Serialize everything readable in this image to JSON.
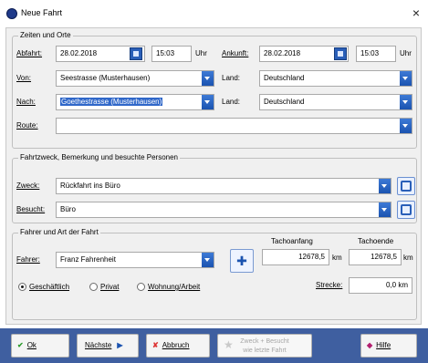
{
  "window": {
    "title": "Neue Fahrt",
    "close": "×"
  },
  "groups": {
    "zeiten": "Zeiten und Orte",
    "zweck": "Fahrtzweck, Bemerkung und besuchte Personen",
    "fahrer": "Fahrer und Art der Fahrt"
  },
  "zeiten": {
    "abfahrt_label": "Abfahrt:",
    "abfahrt_date": "28.02.2018",
    "abfahrt_time": "15:03",
    "abfahrt_unit": "Uhr",
    "ankunft_label": "Ankunft:",
    "ankunft_date": "28.02.2018",
    "ankunft_time": "15:03",
    "ankunft_unit": "Uhr",
    "von_label": "Von:",
    "von_value": "Seestrasse (Musterhausen)",
    "land1_label": "Land:",
    "land1_value": "Deutschland",
    "nach_label": "Nach:",
    "nach_value": "Goethestrasse (Musterhausen)",
    "land2_label": "Land:",
    "land2_value": "Deutschland",
    "route_label": "Route:",
    "route_value": ""
  },
  "zweck": {
    "zweck_label": "Zweck:",
    "zweck_value": "Rückfahrt ins Büro",
    "besucht_label": "Besucht:",
    "besucht_value": "Büro"
  },
  "fahrer": {
    "fahrer_label": "Fahrer:",
    "fahrer_value": "Franz Fahrenheit",
    "tachoanfang_label": "Tachoanfang",
    "tachoanfang_value": "12678,5",
    "tachoende_label": "Tachoende",
    "tachoende_value": "12678,5",
    "km1": "km",
    "km2": "km",
    "strecke_label": "Strecke:",
    "strecke_value": "0,0 km",
    "radio_geschaeftlich": "Geschäftlich",
    "radio_privat": "Privat",
    "radio_wohnung": "Wohnung/Arbeit",
    "selected": "Geschäftlich"
  },
  "footer": {
    "ok": "Ok",
    "naechste": "Nächste",
    "abbruch": "Abbruch",
    "zweck_besucht_line1": "Zweck + Besucht",
    "zweck_besucht_line2": "wie letzte Fahrt",
    "hilfe": "Hilfe"
  },
  "colors": {
    "accent": "#1b53b0",
    "footer": "#3f5fa0",
    "selection": "#2f67c9"
  }
}
